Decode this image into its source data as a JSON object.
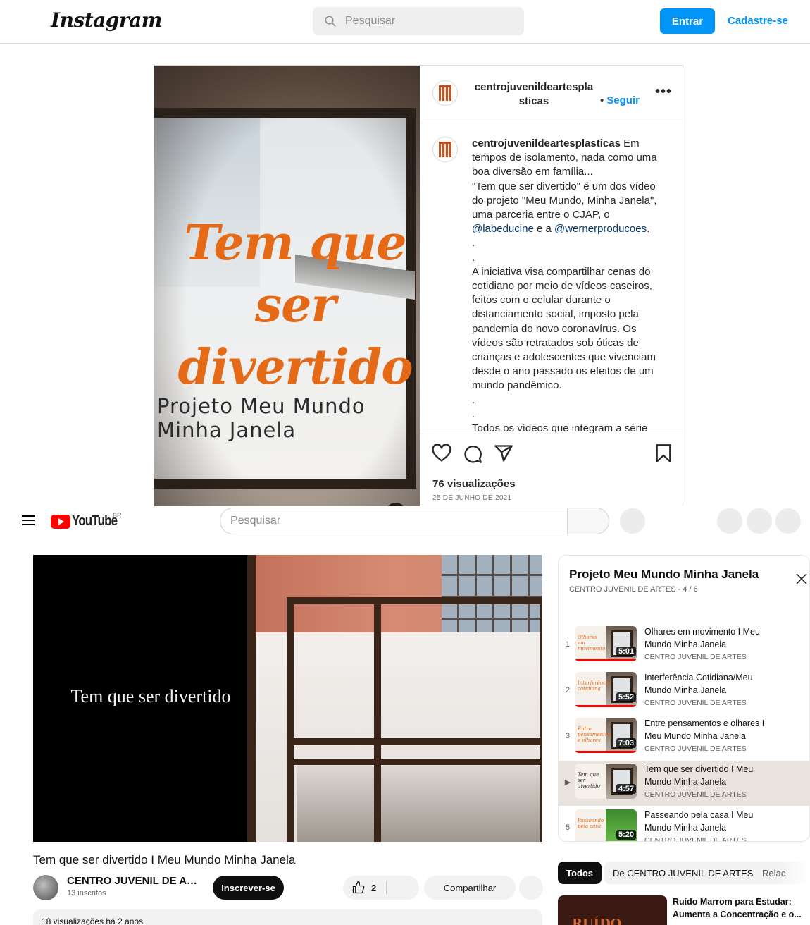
{
  "instagram": {
    "logo": "Instagram",
    "search_placeholder": "Pesquisar",
    "login_label": "Entrar",
    "signup_label": "Cadastre-se",
    "post": {
      "image_title": "Tem que ser divertido",
      "image_subtitle": "Projeto Meu Mundo Minha Janela",
      "username": "centrojuvenildeartesplasticas",
      "follow_separator": "•",
      "follow_label": "Seguir",
      "more_label": "•••",
      "caption_user": "centrojuvenildeartesplasticas",
      "caption_part1": "Em tempos de isolamento, nada como uma boa diversão em família...\n\"Tem que ser divertido\" é um dos vídeo do projeto \"Meu Mundo, Minha Janela\", uma parceria entre o CJAP, o ",
      "mention1": "@labeducine",
      "caption_part2": " e a ",
      "mention2": "@wernerproducoes",
      "caption_part3": ".\n.\n.\nA iniciativa visa compartilhar cenas do cotidiano por meio de vídeos caseiros, feitos com o celular durante o distanciamento social, imposto pela pandemia do novo coronavírus. Os vídeos são retratados sob óticas de crianças e adolescentes que vivenciam desde o ano passado os efeitos de um mundo pandêmico.\n.\n.\nTodos os vídeos que integram a série",
      "views": "76 visualizações",
      "date": "25 DE JUNHO DE 2021"
    }
  },
  "youtube": {
    "logo_text": "YouTube",
    "country_code": "BR",
    "search_placeholder": "Pesquisar",
    "player_title": "Tem que ser divertido",
    "video_title": "Tem que ser divertido I Meu Mundo Minha Janela",
    "channel_name": "CENTRO JUVENIL DE ARTES",
    "subscribers": "13 inscritos",
    "subscribe_label": "Inscrever-se",
    "likes": "2",
    "share_label": "Compartilhar",
    "description_meta": "18 visualizações  há 2 anos",
    "playlist": {
      "title": "Projeto Meu Mundo Minha Janela",
      "subtitle": "CENTRO JUVENIL DE ARTES - 4 / 6",
      "items": [
        {
          "index": "1",
          "title": "Olhares em movimento I Meu Mundo Minha Janela",
          "channel": "CENTRO JUVENIL DE ARTES",
          "duration": "5:01",
          "thumb_text": "Olhares em movimento"
        },
        {
          "index": "2",
          "title": "Interferência Cotidiana/Meu Mundo Minha Janela",
          "channel": "CENTRO JUVENIL DE ARTES",
          "duration": "5:52",
          "thumb_text": "Interferência cotidiana"
        },
        {
          "index": "3",
          "title": "Entre pensamentos e olhares I Meu Mundo Minha Janela",
          "channel": "CENTRO JUVENIL DE ARTES",
          "duration": "7:03",
          "thumb_text": "Entre pensamentos e olhares"
        },
        {
          "index": "▶",
          "title": "Tem que ser divertido I Meu Mundo Minha Janela",
          "channel": "CENTRO JUVENIL DE ARTES",
          "duration": "4:57",
          "thumb_text": "Tem que ser divertido"
        },
        {
          "index": "5",
          "title": "Passeando pela casa I Meu Mundo Minha Janela",
          "channel": "CENTRO JUVENIL DE ARTES",
          "duration": "5:20",
          "thumb_text": "Passeando pela casa"
        }
      ]
    },
    "chips": [
      "Todos",
      "De CENTRO JUVENIL DE ARTES",
      "Relac"
    ],
    "recommended": {
      "thumb_text": "RUÍDO MARROM",
      "title": "Ruído Marrom para Estudar: Aumenta a Concentração e o..."
    }
  },
  "colors": {
    "ig_blue": "#0095f6",
    "title_orange": "#e46a17",
    "yt_red": "#ff0000",
    "active_item": "#eae3dd"
  }
}
